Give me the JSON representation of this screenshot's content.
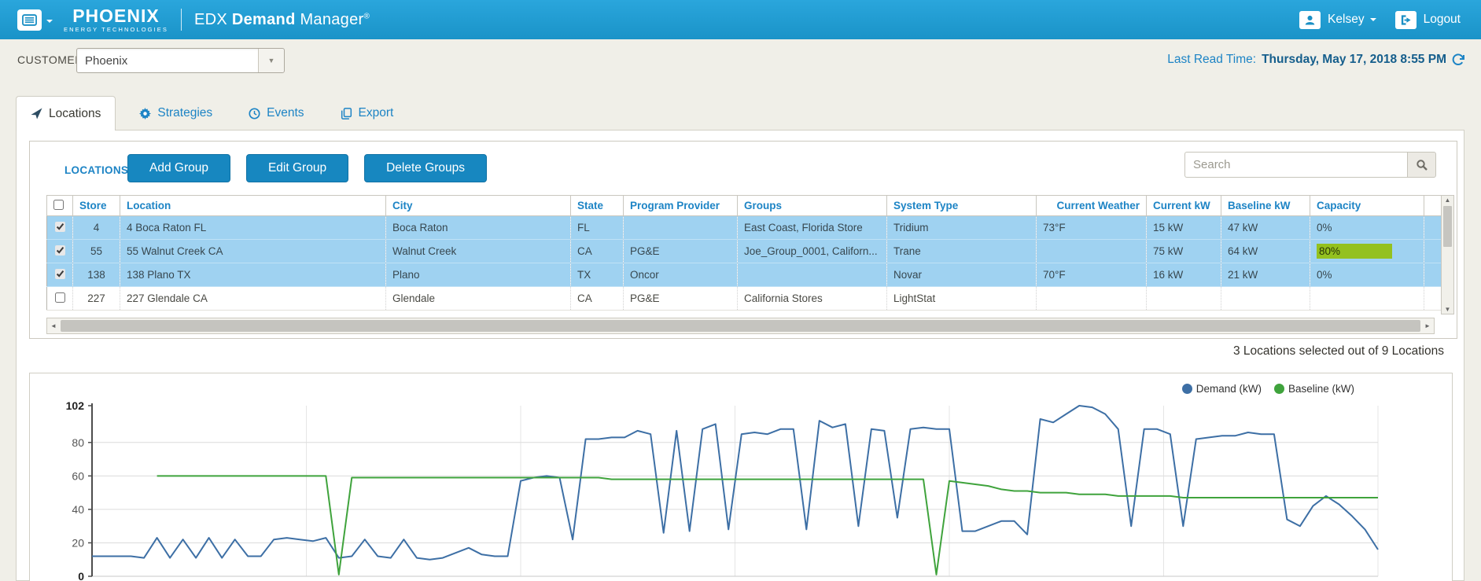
{
  "header": {
    "brand_primary": "PHOENIX",
    "brand_secondary": "ENERGY TECHNOLOGIES",
    "app_title_prefix": "EDX",
    "app_title_bold": "Demand",
    "app_title_light": "Manager",
    "app_title_reg": "®",
    "user_name": "Kelsey",
    "logout_label": "Logout"
  },
  "subheader": {
    "customer_label": "CUSTOMER",
    "customer_value": "Phoenix",
    "last_read_label": "Last Read Time:",
    "last_read_value": "Thursday, May 17, 2018 8:55 PM"
  },
  "tabs": {
    "locations": "Locations",
    "strategies": "Strategies",
    "events": "Events",
    "export": "Export"
  },
  "locations_panel": {
    "title": "LOCATIONS",
    "add_group_label": "Add Group",
    "edit_group_label": "Edit Group",
    "delete_groups_label": "Delete Groups",
    "search_placeholder": "Search",
    "table": {
      "columns": {
        "store": "Store",
        "location": "Location",
        "city": "City",
        "state": "State",
        "program_provider": "Program Provider",
        "groups": "Groups",
        "system_type": "System Type",
        "current_weather": "Current Weather",
        "current_kw": "Current kW",
        "baseline_kw": "Baseline kW",
        "capacity": "Capacity"
      },
      "rows": [
        {
          "selected": true,
          "store": "4",
          "location": "4 Boca Raton FL",
          "city": "Boca Raton",
          "state": "FL",
          "program_provider": "",
          "groups": "East Coast, Florida Store",
          "system_type": "Tridium",
          "current_weather": "73°F",
          "current_kw": "15 kW",
          "baseline_kw": "47 kW",
          "capacity": "0%"
        },
        {
          "selected": true,
          "store": "55",
          "location": "55 Walnut Creek CA",
          "city": "Walnut Creek",
          "state": "CA",
          "program_provider": "PG&E",
          "groups": "Joe_Group_0001, Californ...",
          "system_type": "Trane",
          "current_weather": "",
          "current_kw": "75 kW",
          "baseline_kw": "64 kW",
          "capacity": "80%"
        },
        {
          "selected": true,
          "store": "138",
          "location": "138 Plano TX",
          "city": "Plano",
          "state": "TX",
          "program_provider": "Oncor",
          "groups": "",
          "system_type": "Novar",
          "current_weather": "70°F",
          "current_kw": "16 kW",
          "baseline_kw": "21 kW",
          "capacity": "0%"
        },
        {
          "selected": false,
          "store": "227",
          "location": "227 Glendale CA",
          "city": "Glendale",
          "state": "CA",
          "program_provider": "PG&E",
          "groups": "California Stores",
          "system_type": "LightStat",
          "current_weather": "",
          "current_kw": "",
          "baseline_kw": "",
          "capacity": ""
        }
      ]
    },
    "selection_summary": "3 Locations selected out of 9 Locations"
  },
  "chart_data": {
    "type": "line",
    "title": "",
    "xlabel": "",
    "ylabel": "",
    "ylim": [
      0,
      102
    ],
    "yticks": [
      0,
      20,
      40,
      60,
      80,
      102
    ],
    "grid": true,
    "legend_position": "top-right",
    "x_axis_labels_visible": false,
    "series": [
      {
        "name": "Demand (kW)",
        "color": "#3d6fa5",
        "values": [
          12,
          12,
          12,
          12,
          11,
          23,
          11,
          22,
          11,
          23,
          11,
          22,
          12,
          12,
          22,
          23,
          22,
          21,
          23,
          11,
          12,
          22,
          12,
          11,
          22,
          11,
          10,
          11,
          14,
          17,
          13,
          12,
          12,
          57,
          59,
          60,
          59,
          22,
          82,
          82,
          83,
          83,
          87,
          85,
          26,
          87,
          27,
          88,
          91,
          28,
          85,
          86,
          85,
          88,
          88,
          28,
          93,
          89,
          91,
          30,
          88,
          87,
          35,
          88,
          89,
          88,
          88,
          27,
          27,
          30,
          33,
          33,
          25,
          94,
          92,
          97,
          102,
          101,
          97,
          88,
          30,
          88,
          88,
          85,
          30,
          82,
          83,
          84,
          84,
          86,
          85,
          85,
          34,
          30,
          42,
          48,
          43,
          36,
          28,
          16
        ]
      },
      {
        "name": "Baseline (kW)",
        "color": "#3fa33c",
        "values": [
          null,
          null,
          null,
          null,
          null,
          60,
          60,
          60,
          60,
          60,
          60,
          60,
          60,
          60,
          60,
          60,
          60,
          60,
          60,
          1,
          59,
          59,
          59,
          59,
          59,
          59,
          59,
          59,
          59,
          59,
          59,
          59,
          59,
          59,
          59,
          59,
          59,
          59,
          59,
          59,
          58,
          58,
          58,
          58,
          58,
          58,
          58,
          58,
          58,
          58,
          58,
          58,
          58,
          58,
          58,
          58,
          58,
          58,
          58,
          58,
          58,
          58,
          58,
          58,
          58,
          1,
          57,
          56,
          55,
          54,
          52,
          51,
          51,
          50,
          50,
          50,
          49,
          49,
          49,
          48,
          48,
          48,
          48,
          48,
          47,
          47,
          47,
          47,
          47,
          47,
          47,
          47,
          47,
          47,
          47,
          47,
          47,
          47,
          47,
          47
        ]
      }
    ]
  }
}
